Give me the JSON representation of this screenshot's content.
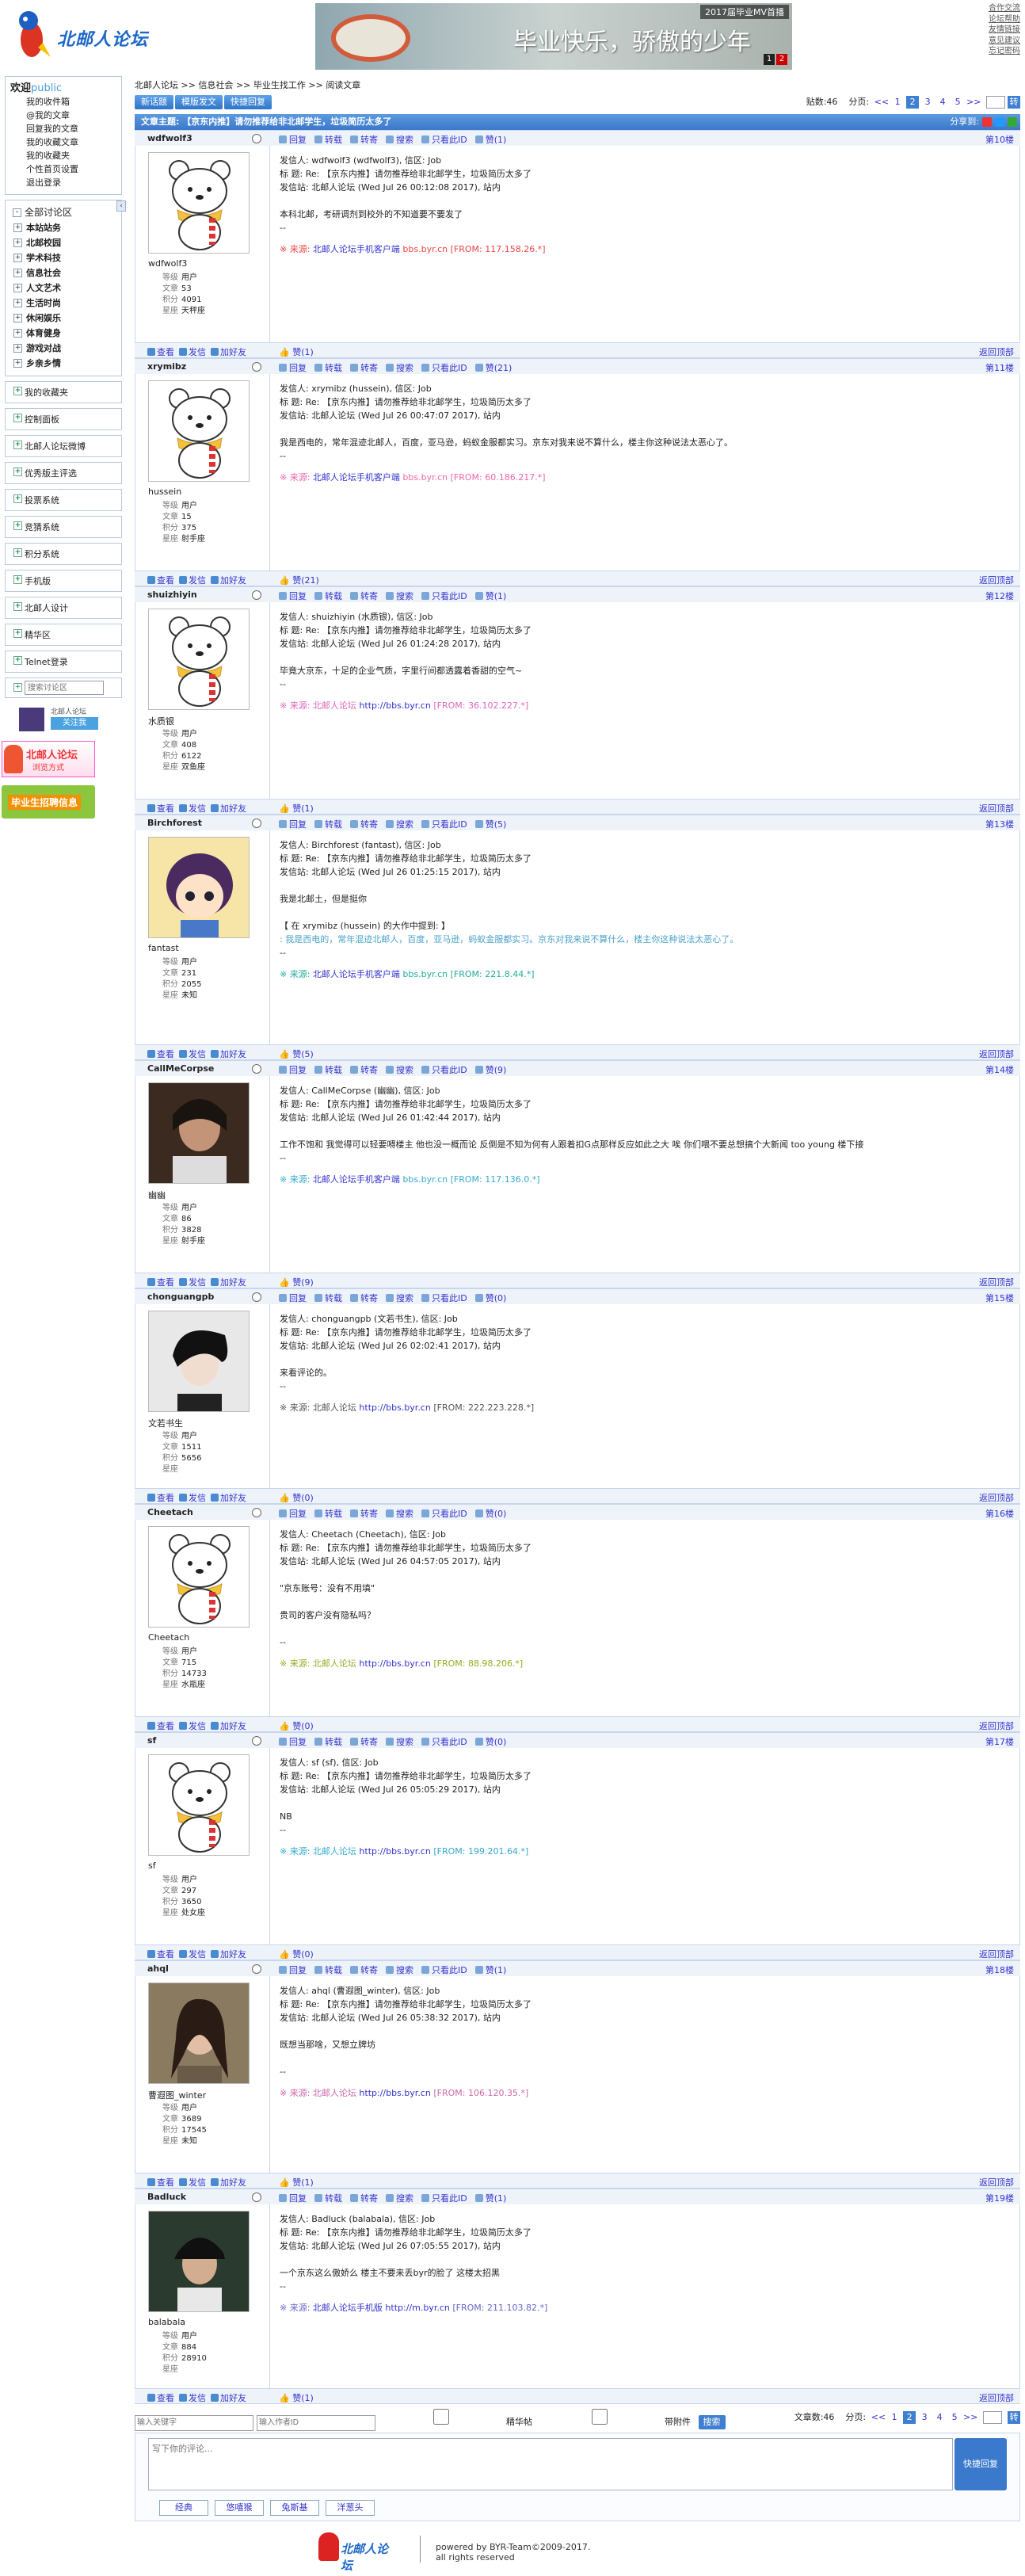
{
  "header": {
    "logo_text": "北邮人论坛",
    "banner_tag": "2017届毕业MV首播",
    "banner_text": "毕业快乐，骄傲的少年",
    "banner_pages": [
      "1",
      "2"
    ],
    "top_links": [
      "合作交流",
      "论坛帮助",
      "友情链接",
      "意见建议",
      "忘记密码"
    ]
  },
  "sidebar": {
    "welcome_title": "欢迎",
    "welcome_user": "public",
    "user_links": [
      "我的收件箱",
      "@我的文章",
      "回复我的文章",
      "我的收藏文章",
      "我的收藏夹",
      "个性首页设置",
      "退出登录"
    ],
    "section_title": "全部讨论区",
    "sections": [
      "本站站务",
      "北邮校园",
      "学术科技",
      "信息社会",
      "人文艺术",
      "生活时尚",
      "休闲娱乐",
      "体育健身",
      "游戏对战",
      "乡亲乡情"
    ],
    "items": [
      "我的收藏夹",
      "控制面板",
      "北邮人论坛微博",
      "优秀版主评选",
      "投票系统",
      "竞猜系统",
      "积分系统",
      "手机版",
      "北邮人设计",
      "精华区",
      "Telnet登录"
    ],
    "search_placeholder": "搜索讨论区",
    "promo1_text": "北邮人论坛",
    "promo1_btn": "关注我",
    "promo2_title": "北邮人论坛",
    "promo2_sub": "浏览方式",
    "promo3_text": "毕业生招聘信息"
  },
  "crumb": [
    "北邮人论坛",
    ">>",
    "信息社会",
    ">>",
    "毕业生找工作",
    ">>",
    "阅读文章"
  ],
  "toolbar": {
    "btns": [
      "新话题",
      "模版发文",
      "快捷回复"
    ],
    "count_label": "贴数:46",
    "page_label": "分页:",
    "pages": [
      "<<",
      "1",
      "2",
      "3",
      "4",
      "5",
      ">>"
    ],
    "go": "转"
  },
  "subject": {
    "text": "文章主题: 【京东内推】请勿推荐给非北邮学生，垃圾简历太多了",
    "share": "分享到:"
  },
  "actions": [
    "回复",
    "转载",
    "转寄",
    "搜索",
    "只看此ID",
    "赞(1)"
  ],
  "foot_actions": [
    "查看",
    "发信",
    "加好友"
  ],
  "back_top": "返回顶部",
  "stat_labels": [
    "等级",
    "文章",
    "积分",
    "星座"
  ],
  "posts": [
    {
      "user": "wdfwolf3",
      "floor": "第10楼",
      "likes": "赞(1)",
      "act_like": "赞(1)",
      "nick": "wdfwolf3",
      "stats": [
        "用户",
        "53",
        "4091",
        "天秤座"
      ],
      "av": "bear",
      "lines": [
        "发信人: wdfwolf3 (wdfwolf3), 信区: Job",
        "标  题: Re: 【京东内推】请勿推荐给非北邮学生，垃圾简历太多了",
        "发信站: 北邮人论坛 (Wed Jul 26 00:12:08 2017), 站内",
        "",
        "本科北邮，考研调剂到校外的不知道要不要发了",
        "--"
      ],
      "src_pre": "※ 来源: ",
      "src_link": "北邮人论坛手机客户端",
      "src_host": " bbs.byr.cn",
      "src_from": " [FROM: 117.158.26.*]",
      "src_color": "#e44"
    },
    {
      "user": "xrymibz",
      "floor": "第11楼",
      "likes": "赞(21)",
      "act_like": "赞(21)",
      "nick": "hussein",
      "stats": [
        "用户",
        "15",
        "375",
        "射手座"
      ],
      "av": "bear",
      "lines": [
        "发信人: xrymibz (hussein), 信区: Job",
        "标  题: Re: 【京东内推】请勿推荐给非北邮学生，垃圾简历太多了",
        "发信站: 北邮人论坛 (Wed Jul 26 00:47:07 2017), 站内",
        "",
        "我是西电的，常年混迹北邮人，百度，亚马逊，蚂蚁金服都实习。京东对我来说不算什么，楼主你这种说法太恶心了。",
        "--"
      ],
      "src_pre": "※ 来源: ",
      "src_link": "北邮人论坛手机客户端",
      "src_host": " bbs.byr.cn",
      "src_from": " [FROM: 60.186.217.*]",
      "src_color": "#e6a"
    },
    {
      "user": "shuizhiyin",
      "floor": "第12楼",
      "likes": "赞(1)",
      "act_like": "赞(1)",
      "nick": "水质银",
      "stats": [
        "用户",
        "408",
        "6122",
        "双鱼座"
      ],
      "av": "bear",
      "lines": [
        "发信人: shuizhiyin (水质银), 信区: Job",
        "标  题: Re: 【京东内推】请勿推荐给非北邮学生，垃圾简历太多了",
        "发信站: 北邮人论坛 (Wed Jul 26 01:24:28 2017), 站内",
        "",
        "毕竟大京东，十足的企业气质，字里行间都透露着香甜的空气~",
        "--"
      ],
      "src_pre": "※ 来源: ",
      "src_link": "北邮人论坛",
      "src_host": " http://bbs.byr.cn",
      "src_from": " [FROM: 36.102.227.*]",
      "src_color": "#d6b"
    },
    {
      "user": "Birchforest",
      "floor": "第13楼",
      "likes": "赞(5)",
      "act_like": "赞(5)",
      "nick": "fantast",
      "stats": [
        "用户",
        "231",
        "2055",
        "未知"
      ],
      "av": "anime",
      "lines": [
        "发信人: Birchforest (fantast), 信区: Job",
        "标  题: Re: 【京东内推】请勿推荐给非北邮学生，垃圾简历太多了",
        "发信站: 北邮人论坛 (Wed Jul 26 01:25:15 2017), 站内",
        "",
        "我是北邮土，但是挺你",
        "",
        "【 在 xrymibz (hussein) 的大作中提到: 】"
      ],
      "quote": ": 我是西电的，常年混迹北邮人，百度，亚马逊，蚂蚁金服都实习。京东对我来说不算什么，楼主你这种说法太恶心了。",
      "after": [
        "--"
      ],
      "src_pre": "※ 来源: ",
      "src_link": "北邮人论坛手机客户端",
      "src_host": " bbs.byr.cn",
      "src_from": " [FROM: 221.8.44.*]",
      "src_color": "#2a9"
    },
    {
      "user": "CallMeCorpse",
      "floor": "第14楼",
      "likes": "赞(9)",
      "act_like": "赞(9)",
      "nick": "幽幽",
      "stats": [
        "用户",
        "86",
        "3828",
        "射手座"
      ],
      "av": "photo1",
      "lines": [
        "发信人: CallMeCorpse (幽幽), 信区: Job",
        "标  题: Re: 【京东内推】请勿推荐给非北邮学生，垃圾简历太多了",
        "发信站: 北邮人论坛 (Wed Jul 26 01:42:44 2017), 站内",
        "",
        "工作不饱和  我觉得可以轻要嘚楼主 他也没一概而论 反倒是不知为何有人跟着扣G点那样反应如此之大  唉  你们喂不要总想搞个大新闻 too young 楼下接",
        "--"
      ],
      "src_pre": "※ 来源: ",
      "src_link": "北邮人论坛手机客户端",
      "src_host": " bbs.byr.cn",
      "src_from": " [FROM: 117.136.0.*]",
      "src_color": "#3ac"
    },
    {
      "user": "chonguangpb",
      "floor": "第15楼",
      "likes": "赞(0)",
      "act_like": "赞(0)",
      "nick": "文若书生",
      "stats": [
        "用户",
        "1511",
        "5656",
        ""
      ],
      "av": "photo2",
      "lines": [
        "发信人: chonguangpb (文若书生), 信区: Job",
        "标  题: Re: 【京东内推】请勿推荐给非北邮学生，垃圾简历太多了",
        "发信站: 北邮人论坛 (Wed Jul 26 02:02:41 2017), 站内",
        "",
        "来看评论的。",
        "--"
      ],
      "src_pre": "※ 来源: ",
      "src_link": "北邮人论坛",
      "src_host": " http://bbs.byr.cn",
      "src_from": " [FROM: 222.223.228.*]",
      "src_color": "#555"
    },
    {
      "user": "Cheetach",
      "floor": "第16楼",
      "likes": "赞(0)",
      "act_like": "赞(0)",
      "nick": "Cheetach",
      "stats": [
        "用户",
        "715",
        "14733",
        "水瓶座"
      ],
      "av": "bear",
      "lines": [
        "发信人: Cheetach (Cheetach), 信区: Job",
        "标  题: Re: 【京东内推】请勿推荐给非北邮学生，垃圾简历太多了",
        "发信站: 北邮人论坛 (Wed Jul 26 04:57:05 2017), 站内",
        "",
        "\"京东账号：没有不用填\"",
        "",
        "贵司的客户没有隐私吗？",
        "",
        "--"
      ],
      "src_pre": "※ 来源: ",
      "src_link": "北邮人论坛",
      "src_host": " http://bbs.byr.cn",
      "src_from": " [FROM: 88.98.206.*]",
      "src_color": "#9a2"
    },
    {
      "user": "sf",
      "floor": "第17楼",
      "likes": "赞(0)",
      "act_like": "赞(0)",
      "nick": "sf",
      "stats": [
        "用户",
        "297",
        "3650",
        "处女座"
      ],
      "av": "bear",
      "lines": [
        "发信人: sf (sf), 信区: Job",
        "标  题: Re: 【京东内推】请勿推荐给非北邮学生，垃圾简历太多了",
        "发信站: 北邮人论坛 (Wed Jul 26 05:05:29 2017), 站内",
        "",
        "NB",
        "--"
      ],
      "src_pre": "※ 来源: ",
      "src_link": "北邮人论坛",
      "src_host": " http://bbs.byr.cn",
      "src_from": " [FROM: 199.201.64.*]",
      "src_color": "#3ac"
    },
    {
      "user": "ahql",
      "floor": "第18楼",
      "likes": "赞(1)",
      "act_like": "赞(1)",
      "nick": "曹遐图_winter",
      "stats": [
        "用户",
        "3689",
        "17545",
        "未知"
      ],
      "av": "photo3",
      "lines": [
        "发信人: ahql (曹遐图_winter), 信区: Job",
        "标  题: Re: 【京东内推】请勿推荐给非北邮学生，垃圾简历太多了",
        "发信站: 北邮人论坛 (Wed Jul 26 05:38:32 2017), 站内",
        "",
        "既想当那啥，又想立牌坊",
        "",
        "--"
      ],
      "src_pre": "※ 来源: ",
      "src_link": "北邮人论坛",
      "src_host": " http://bbs.byr.cn",
      "src_from": " [FROM: 106.120.35.*]",
      "src_color": "#c6a"
    },
    {
      "user": "Badluck",
      "floor": "第19楼",
      "likes": "赞(1)",
      "act_like": "赞(1)",
      "nick": "balabala",
      "stats": [
        "用户",
        "884",
        "28910",
        ""
      ],
      "av": "photo4",
      "lines": [
        "发信人: Badluck (balabala), 信区: Job",
        "标  题: Re: 【京东内推】请勿推荐给非北邮学生，垃圾简历太多了",
        "发信站: 北邮人论坛 (Wed Jul 26 07:05:55 2017), 站内",
        "",
        "一个京东这么傲娇么   楼主不要来丢byr的脸了    这楼太招黑",
        "--"
      ],
      "src_pre": "※ 来源: ",
      "src_link": "北邮人论坛手机版",
      "src_host": " http://m.byr.cn",
      "src_from": " [FROM: 211.103.82.*]",
      "src_color": "#66c"
    }
  ],
  "bottom": {
    "kw_placeholder": "输入关键字",
    "author_placeholder": "输入作者ID",
    "chk1": "精华帖",
    "chk2": "带附件",
    "search": "搜索",
    "count": "文章数:46",
    "page_label": "分页:",
    "pages": [
      "<<",
      "1",
      "2",
      "3",
      "4",
      "5",
      ">>"
    ],
    "go": "转"
  },
  "reply": {
    "placeholder": "写下你的评论...",
    "btn": "快捷回复",
    "emotes": [
      "经典",
      "悠嘻猴",
      "兔斯基",
      "洋葱头"
    ]
  },
  "footer": {
    "logo": "北邮人论坛",
    "line1": "powered by BYR-Team©2009-2017.",
    "line2": "all rights reserved"
  },
  "colors": {
    "accent": "#3f7fd0",
    "link": "#3333cc"
  }
}
